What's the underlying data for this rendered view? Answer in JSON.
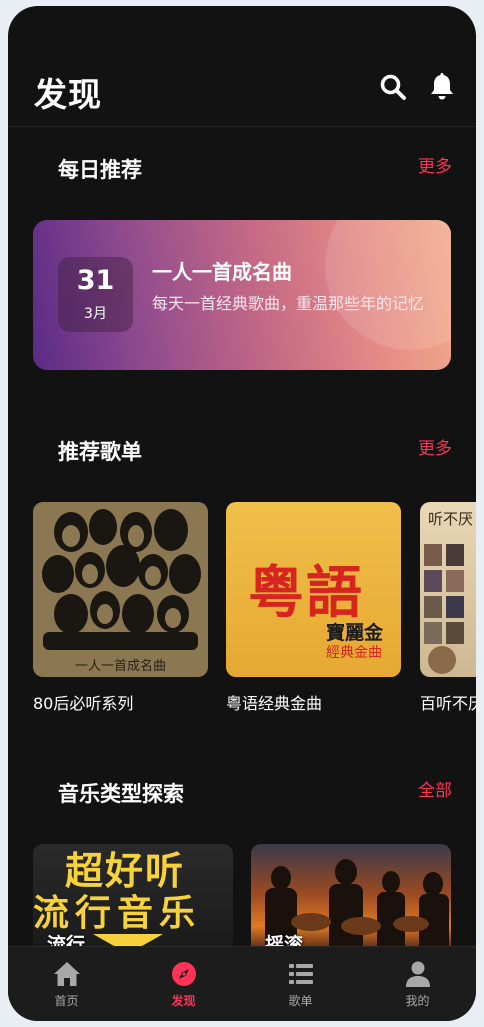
{
  "header": {
    "title": "发现"
  },
  "daily": {
    "section_title": "每日推荐",
    "more_label": "更多",
    "day": "31",
    "month": "3月",
    "title": "一人一首成名曲",
    "subtitle": "每天一首经典歌曲，重温那些年的记忆"
  },
  "playlists": {
    "section_title": "推荐歌单",
    "more_label": "更多",
    "items": [
      {
        "name": "80后必听系列",
        "cover_text": "一人一首成名曲"
      },
      {
        "name": "粤语经典金曲",
        "cover_text": {
          "big": "粤語",
          "sub": "寶麗金",
          "sub2": "經典金曲"
        }
      },
      {
        "name": "百听不厌",
        "cover_text": "听不厌"
      }
    ]
  },
  "genres": {
    "section_title": "音乐类型探索",
    "all_label": "全部",
    "items": [
      {
        "name": "流行",
        "banner_line1": "超好听",
        "banner_line2": "流行音乐"
      },
      {
        "name": "摇滚"
      }
    ]
  },
  "tabbar": {
    "items": [
      {
        "label": "首页",
        "icon": "home-icon"
      },
      {
        "label": "发现",
        "icon": "compass-icon"
      },
      {
        "label": "歌单",
        "icon": "list-icon"
      },
      {
        "label": "我的",
        "icon": "user-icon"
      }
    ],
    "active_index": 1,
    "accent_color": "#ff3355"
  }
}
